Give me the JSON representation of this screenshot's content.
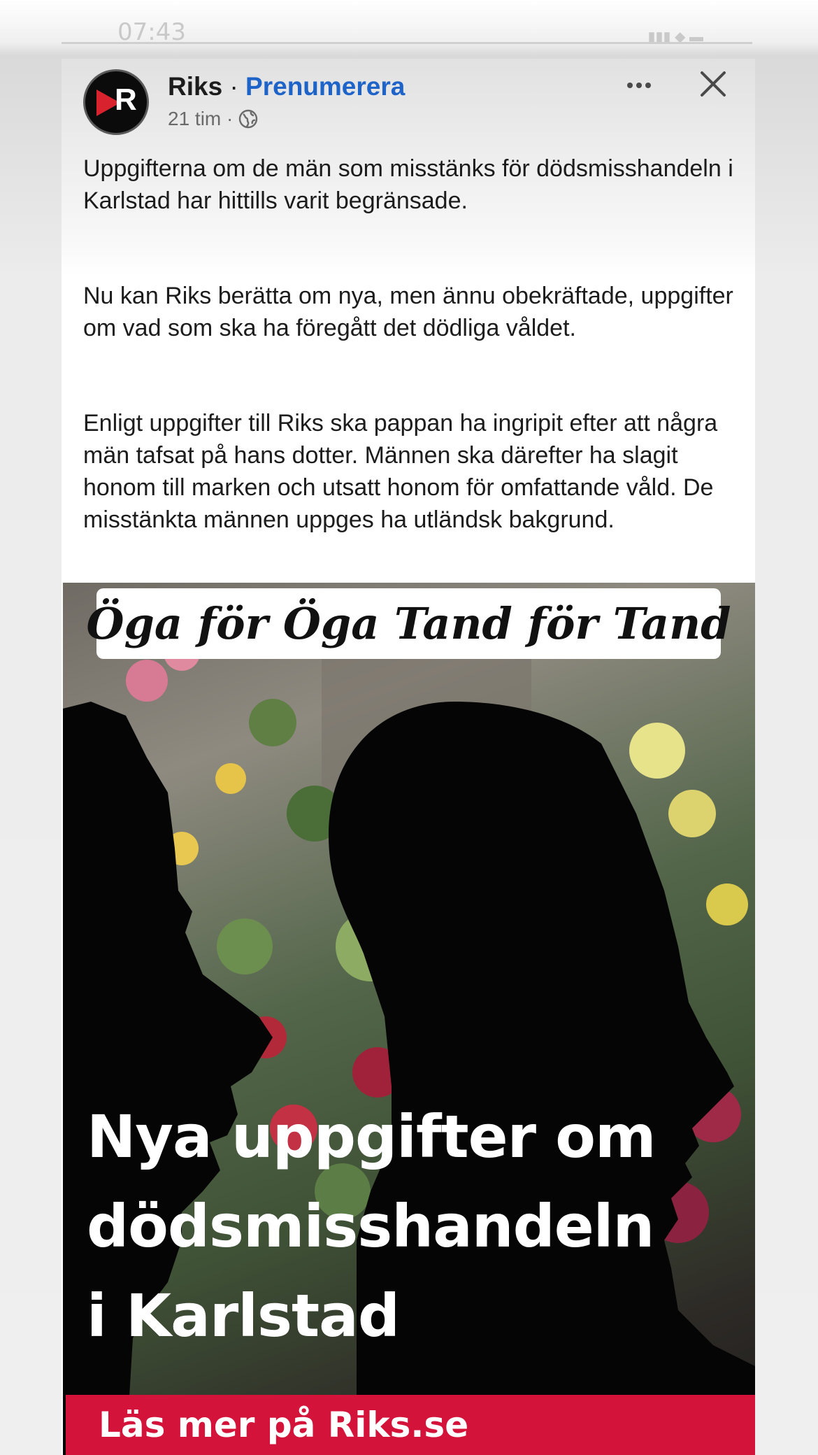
{
  "status_bar": {
    "time": "07:43"
  },
  "post": {
    "page_name": "Riks",
    "separator": "·",
    "subscribe": "Prenumerera",
    "time_ago": "21 tim ·",
    "avatar_letter": "R",
    "paragraphs": [
      "Uppgifterna om de män som misstänks för dödsmisshandeln i Karlstad har hittills varit begränsade.",
      "Nu kan Riks berätta om nya, men ännu obekräftade, uppgifter om vad som ska ha föregått det dödliga våldet.",
      "Enligt uppgifter till Riks ska pappan ha ingripit efter att några män tafsat på hans dotter. Männen ska därefter ha slagit honom till marken och utsatt honom för omfattande våld. De misstänkta männen uppges ha utländsk bakgrund."
    ],
    "icons": [
      "globe-icon",
      "more-icon",
      "close-icon"
    ]
  },
  "image": {
    "banner": "Öga för Öga Tand för Tand",
    "headline": [
      "Nya uppgifter om",
      "dödsmisshandeln",
      "i Karlstad"
    ],
    "footer": "Läs mer på Riks.se"
  },
  "colors": {
    "subscribe_link": "#1d63c8",
    "brand_red": "#d3133a",
    "avatar_red": "#d8232f"
  }
}
